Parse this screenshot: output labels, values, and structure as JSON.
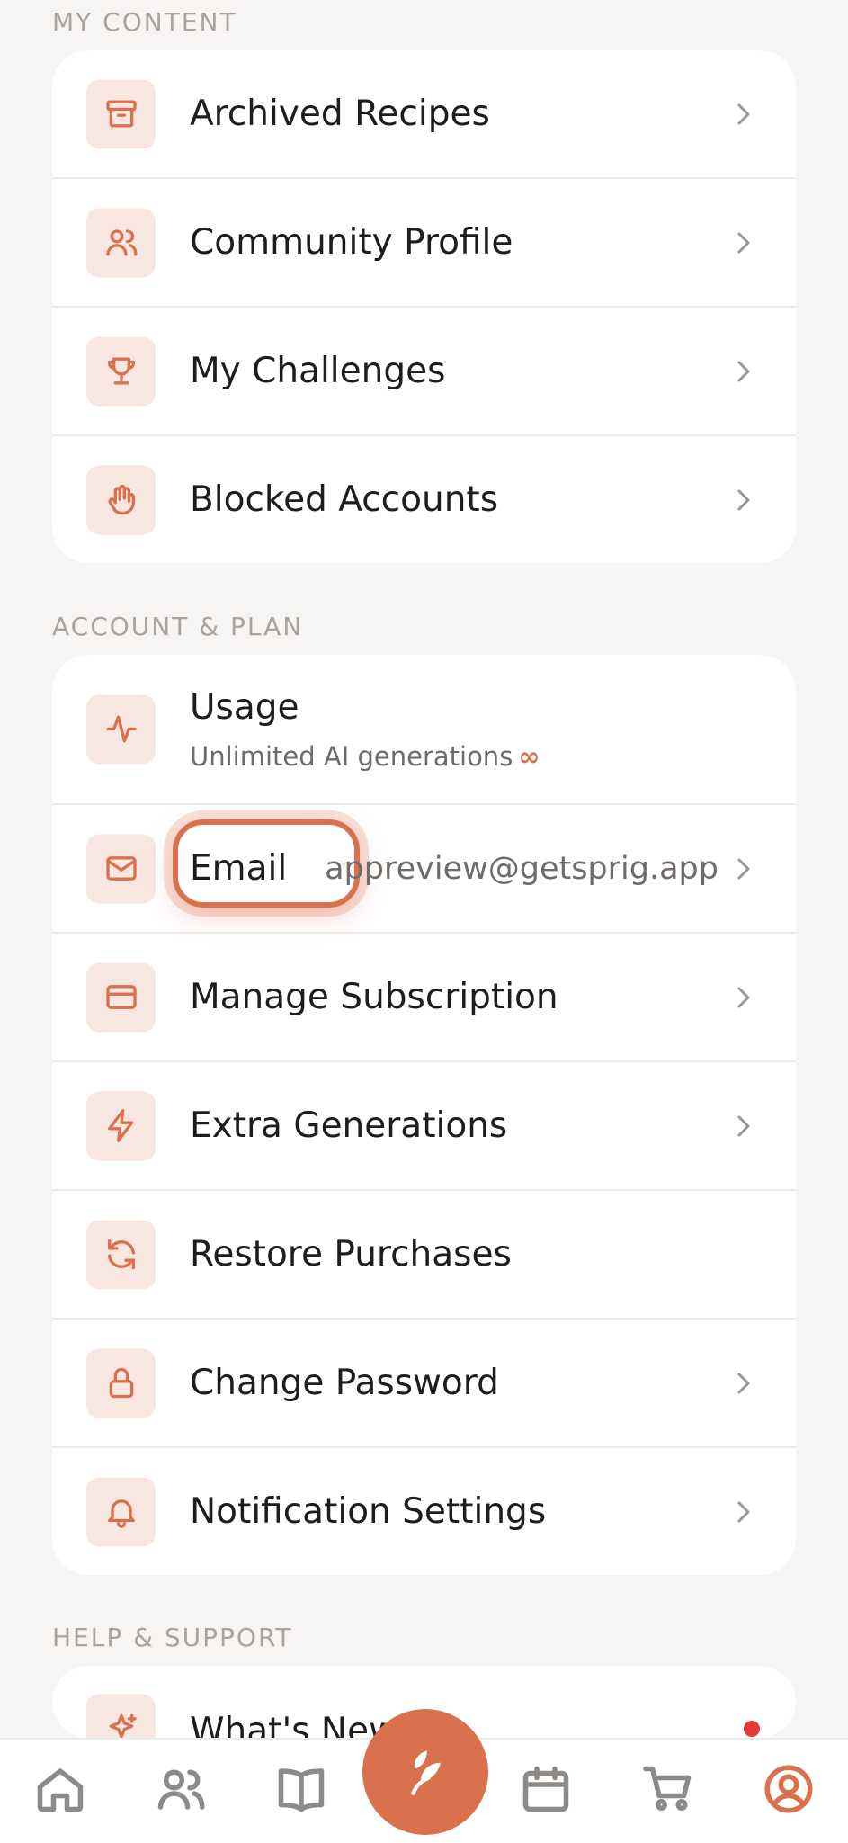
{
  "sections": {
    "my_content": "MY CONTENT",
    "account_plan": "ACCOUNT & PLAN",
    "help_support": "HELP & SUPPORT"
  },
  "my_content": [
    {
      "label": "Archived Recipes",
      "icon": "archive-icon"
    },
    {
      "label": "Community Profile",
      "icon": "users-icon"
    },
    {
      "label": "My Challenges",
      "icon": "trophy-icon"
    },
    {
      "label": "Blocked Accounts",
      "icon": "hand-icon"
    }
  ],
  "account": {
    "usage": {
      "label": "Usage",
      "subtitle": "Unlimited AI generations",
      "infinity": "∞"
    },
    "email": {
      "label": "Email",
      "value": "appreview@getsprig.app"
    },
    "manage_subscription": "Manage Subscription",
    "extra_generations": "Extra Generations",
    "restore_purchases": "Restore Purchases",
    "change_password": "Change Password",
    "notification_settings": "Notification Settings"
  },
  "help": {
    "whats_new": "What's New"
  },
  "nav": [
    "home-icon",
    "community-icon",
    "recipes-book-icon",
    "sprig-logo-icon",
    "calendar-icon",
    "cart-icon",
    "profile-icon"
  ],
  "colors": {
    "accent": "#d9714e",
    "icon_bg": "#f8e7e0",
    "background": "#f7f5f3",
    "notification_dot": "#e23b3b"
  }
}
